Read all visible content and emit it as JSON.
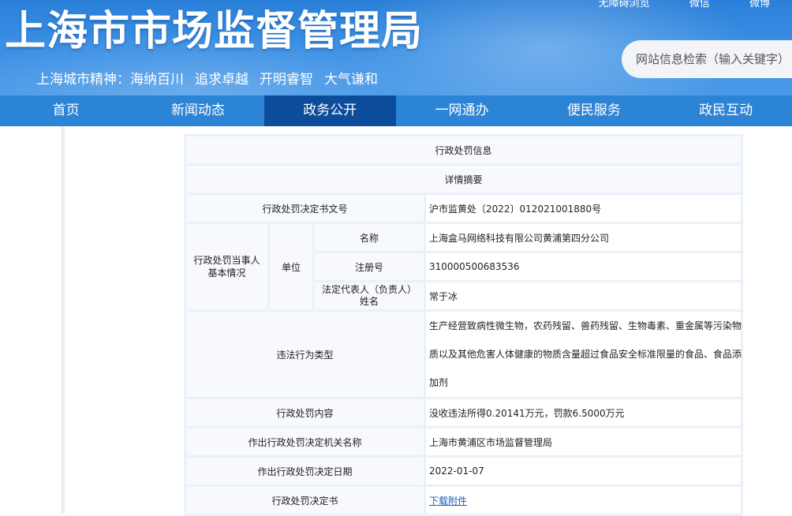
{
  "header": {
    "title": "上海市市场监督管理局",
    "slogan_lead": "上海城市精神：",
    "slogan_parts": [
      "海纳百川",
      "追求卓越",
      "开明睿智",
      "大气谦和"
    ],
    "top_links": [
      "无障碍浏览",
      "微信",
      "微博"
    ],
    "search_placeholder": "网站信息检索（输入关键字）"
  },
  "nav": {
    "items": [
      "首页",
      "新闻动态",
      "政务公开",
      "一网通办",
      "便民服务",
      "政民互动"
    ],
    "active": "政务公开"
  },
  "detail": {
    "title": "行政处罚信息",
    "subtitle": "详情摘要",
    "doc_no_label": "行政处罚决定书文号",
    "doc_no": "沪市监黄处〔2022〕012021001880号",
    "party_label": "行政处罚当事人基本情况",
    "unit_label": "单位",
    "name_label": "名称",
    "name": "上海盒马网络科技有限公司黄浦第四分公司",
    "reg_label": "注册号",
    "reg_no": "310000500683536",
    "legal_rep_label": "法定代表人（负责人）姓名",
    "legal_rep": "常于冰",
    "violation_label": "违法行为类型",
    "violation_lines": [
      "生产经营致病性微生物，农药残留、兽药残留、生物毒素、重金属等污染物",
      "质以及其他危害人体健康的物质含量超过食品安全标准限量的食品、食品添",
      "加剂"
    ],
    "content_label": "行政处罚内容",
    "content": "没收违法所得0.20141万元，罚款6.5000万元",
    "authority_label": "作出行政处罚决定机关名称",
    "authority": "上海市黄浦区市场监督管理局",
    "date_label": "作出行政处罚决定日期",
    "date": "2022-01-07",
    "decision_label": "行政处罚决定书",
    "download_label": "下载附件"
  }
}
